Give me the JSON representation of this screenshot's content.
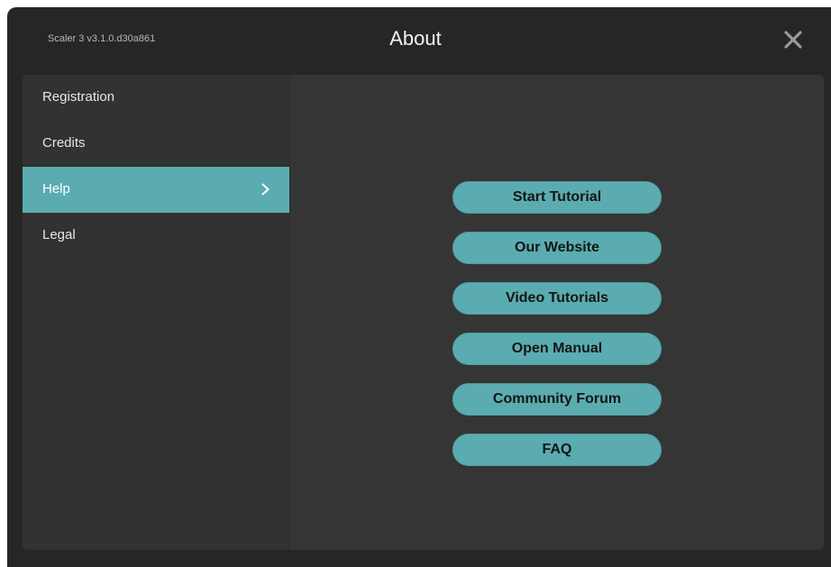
{
  "window": {
    "version": "Scaler 3 v3.1.0.d30a861",
    "title": "About"
  },
  "sidebar": {
    "items": [
      {
        "label": "Registration"
      },
      {
        "label": "Credits"
      },
      {
        "label": "Help"
      },
      {
        "label": "Legal"
      }
    ],
    "active_index": 2
  },
  "help": {
    "buttons": [
      {
        "label": "Start Tutorial"
      },
      {
        "label": "Our Website"
      },
      {
        "label": "Video Tutorials"
      },
      {
        "label": "Open Manual"
      },
      {
        "label": "Community Forum"
      },
      {
        "label": "FAQ"
      }
    ]
  },
  "colors": {
    "accent": "#5aacb0",
    "window_bg": "#262626",
    "panel_bg": "#353535"
  },
  "icons": {
    "close": "close-icon",
    "active_item": "chevron-right-icon"
  }
}
